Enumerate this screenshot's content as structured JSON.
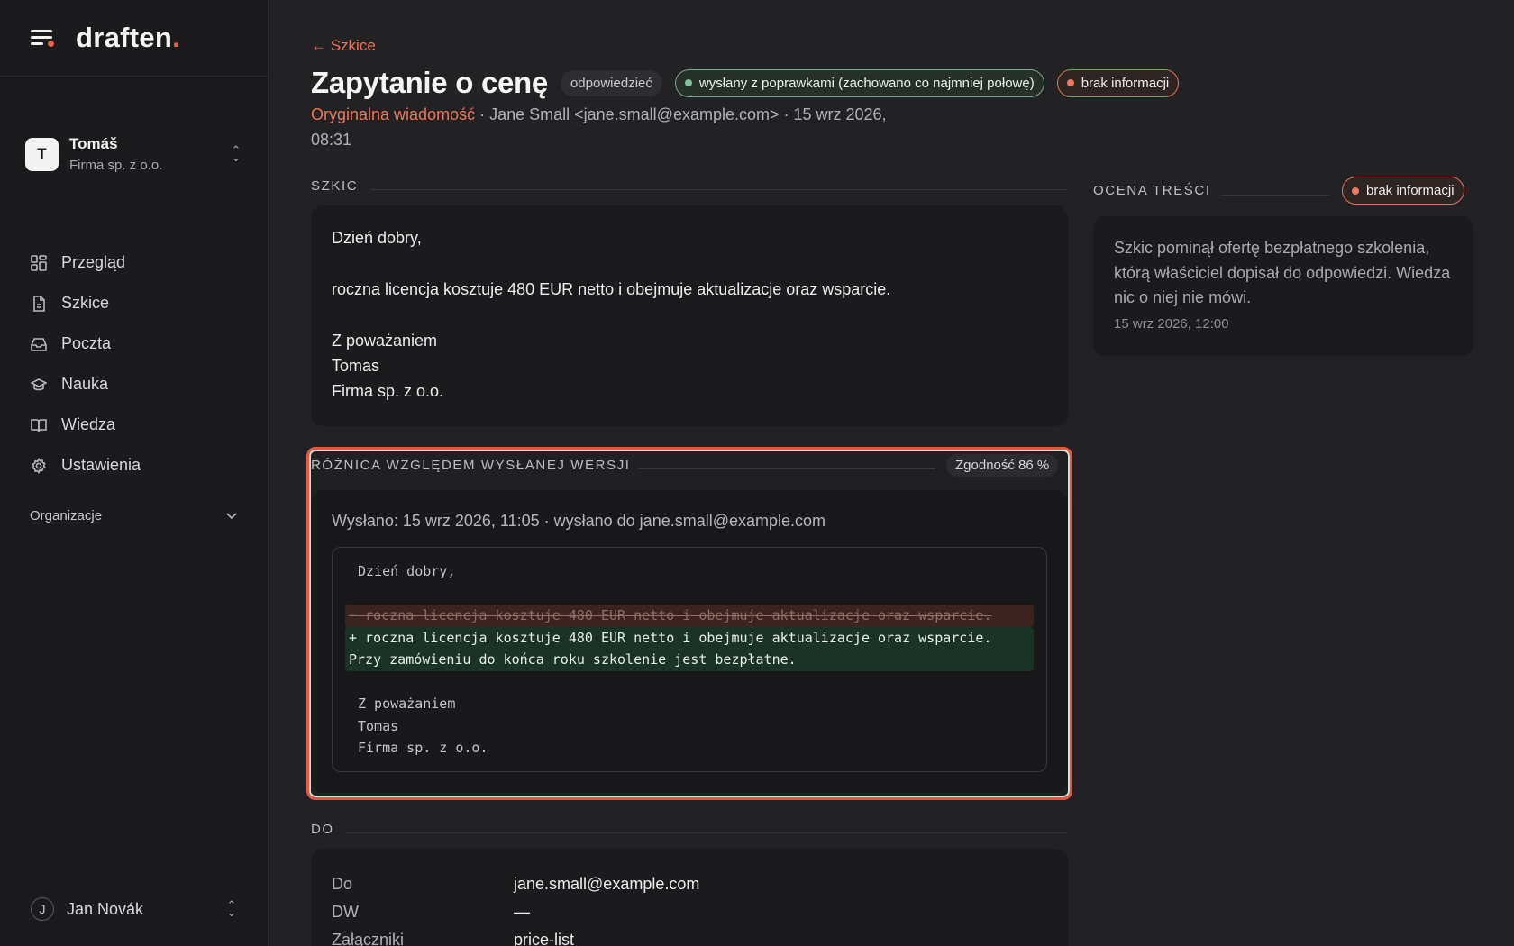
{
  "brand": {
    "name": "draften",
    "suffix": "."
  },
  "org": {
    "initial": "T",
    "name": "Tomáš",
    "company": "Firma sp. z o.o."
  },
  "nav": {
    "items": [
      {
        "label": "Przegląd",
        "icon": "dashboard-icon"
      },
      {
        "label": "Szkice",
        "icon": "document-icon"
      },
      {
        "label": "Poczta",
        "icon": "inbox-icon"
      },
      {
        "label": "Nauka",
        "icon": "graduation-cap-icon"
      },
      {
        "label": "Wiedza",
        "icon": "book-icon"
      },
      {
        "label": "Ustawienia",
        "icon": "gear-icon"
      }
    ],
    "section": "Organizacje"
  },
  "user": {
    "initial": "J",
    "name": "Jan Novák"
  },
  "header": {
    "back": "← Szkice",
    "title": "Zapytanie o cenę",
    "type_tag": "odpowiedzieć",
    "status_sent": "wysłany z poprawkami (zachowano co najmniej połowę)",
    "status_info": "brak informacji",
    "orig_link": "Oryginalna wiadomość",
    "meta_rest": " · Jane Small <jane.small@example.com> · 15 wrz 2026, 08:31"
  },
  "draft": {
    "label": "SZKIC",
    "greeting": "Dzień dobry,",
    "body": "roczna licencja kosztuje 480 EUR netto i obejmuje aktualizacje oraz wsparcie.",
    "closing": "Z poważaniem",
    "name": "Tomas",
    "company": "Firma sp. z o.o."
  },
  "diff": {
    "label": "RÓŻNICA WZGLĘDEM WYSŁANEJ WERSJI",
    "score": "Zgodność 86 %",
    "sent_info": "Wysłano: 15 wrz 2026, 11:05 · wysłano do jane.small@example.com",
    "lines": {
      "l1": "Dzień dobry,",
      "del": "− roczna licencja kosztuje 480 EUR netto i obejmuje aktualizacje oraz wsparcie.",
      "add1": "+ roczna licencja kosztuje 480 EUR netto i obejmuje aktualizacje oraz wsparcie.",
      "add2": "Przy zamówieniu do końca roku szkolenie jest bezpłatne.",
      "c1": "Z poważaniem",
      "c2": "Tomas",
      "c3": "Firma sp. z o.o."
    }
  },
  "recipients": {
    "label": "DO",
    "rows": [
      {
        "key": "Do",
        "value": "jane.small@example.com"
      },
      {
        "key": "DW",
        "value": "—"
      },
      {
        "key": "Załączniki",
        "value": "price-list"
      }
    ]
  },
  "rating": {
    "label": "OCENA TREŚCI",
    "badge": "brak informacji",
    "text": "Szkic pominął ofertę bezpłatnego szkolenia, którą właściciel dopisał do odpowiedzi. Wiedza nic o niej nie mówi.",
    "date": "15 wrz 2026, 12:00"
  },
  "colors": {
    "accent": "#e8604c",
    "link": "#ec7558",
    "ok": "#7fbfa0",
    "diff_frame": "#e8563e"
  }
}
